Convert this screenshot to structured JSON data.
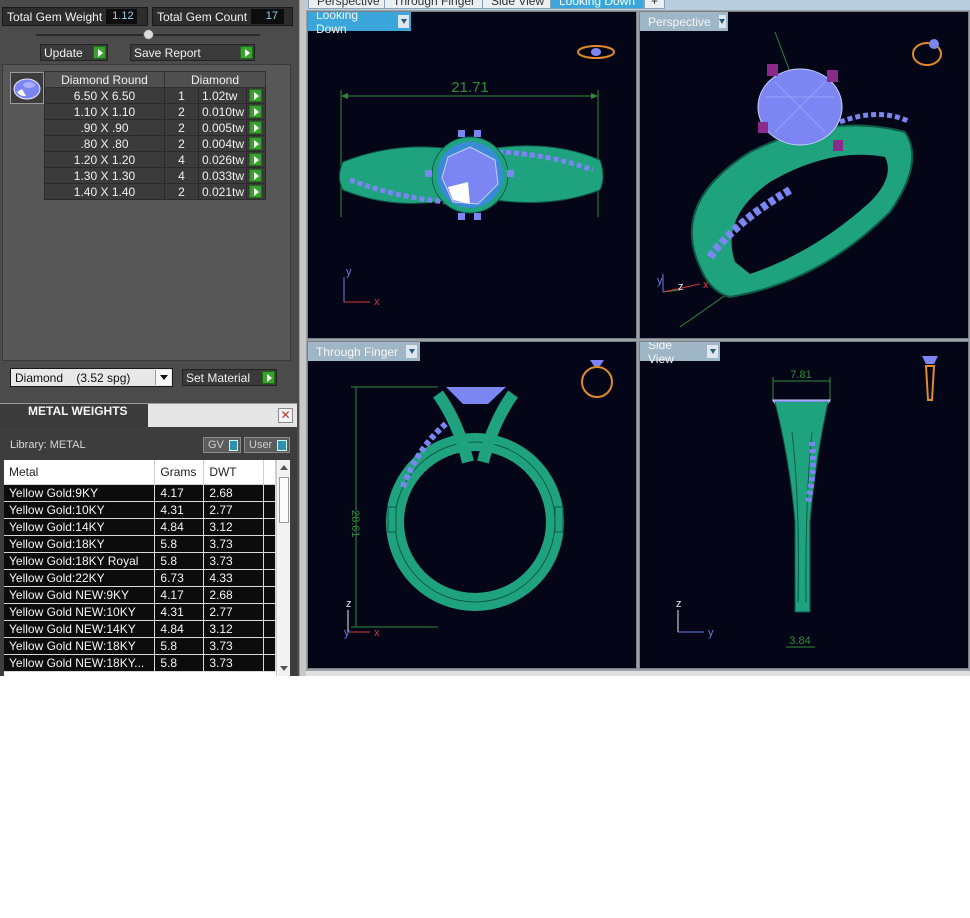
{
  "gem_summary": {
    "total_weight_label": "Total Gem Weight",
    "total_weight_value": "1.12",
    "total_count_label": "Total Gem Count",
    "total_count_value": "17"
  },
  "actions": {
    "update_label": "Update",
    "save_report_label": "Save Report",
    "set_material_label": "Set Material"
  },
  "gem_table": {
    "headers": [
      "Diamond Round",
      "Diamond"
    ],
    "rows": [
      {
        "size": "6.50 X 6.50",
        "count": "1",
        "weight": "1.02tw"
      },
      {
        "size": "1.10 X 1.10",
        "count": "2",
        "weight": "0.010tw"
      },
      {
        "size": ".90 X .90",
        "count": "2",
        "weight": "0.005tw"
      },
      {
        "size": ".80 X .80",
        "count": "2",
        "weight": "0.004tw"
      },
      {
        "size": "1.20 X 1.20",
        "count": "4",
        "weight": "0.026tw"
      },
      {
        "size": "1.30 X 1.30",
        "count": "4",
        "weight": "0.033tw"
      },
      {
        "size": "1.40 X 1.40",
        "count": "2",
        "weight": "0.021tw"
      }
    ]
  },
  "material": {
    "selected": "Diamond    (3.52 spg)"
  },
  "metal_weights": {
    "title": "METAL WEIGHTS",
    "library_label": "Library: METAL",
    "gv_label": "GV",
    "user_label": "User",
    "headers": [
      "Metal",
      "Grams",
      "DWT"
    ],
    "rows": [
      {
        "metal": "Yellow Gold:9KY",
        "grams": "4.17",
        "dwt": "2.68"
      },
      {
        "metal": "Yellow Gold:10KY",
        "grams": "4.31",
        "dwt": "2.77"
      },
      {
        "metal": "Yellow Gold:14KY",
        "grams": "4.84",
        "dwt": "3.12"
      },
      {
        "metal": "Yellow Gold:18KY",
        "grams": "5.8",
        "dwt": "3.73"
      },
      {
        "metal": "Yellow Gold:18KY Royal",
        "grams": "5.8",
        "dwt": "3.73"
      },
      {
        "metal": "Yellow Gold:22KY",
        "grams": "6.73",
        "dwt": "4.33"
      },
      {
        "metal": "Yellow Gold NEW:9KY",
        "grams": "4.17",
        "dwt": "2.68"
      },
      {
        "metal": "Yellow Gold NEW:10KY",
        "grams": "4.31",
        "dwt": "2.77"
      },
      {
        "metal": "Yellow Gold NEW:14KY",
        "grams": "4.84",
        "dwt": "3.12"
      },
      {
        "metal": "Yellow Gold NEW:18KY",
        "grams": "5.8",
        "dwt": "3.73"
      },
      {
        "metal": "Yellow Gold NEW:18KY...",
        "grams": "5.8",
        "dwt": "3.73"
      }
    ]
  },
  "top_tabs": [
    "Perspective",
    "Through Finger",
    "Side View",
    "Looking Down"
  ],
  "viewports": {
    "looking_down": {
      "label": "Looking Down",
      "dimension": "21.71",
      "axis_a": "y",
      "axis_b": "x"
    },
    "perspective": {
      "label": "Perspective",
      "axis_a": "y",
      "axis_b": "z",
      "axis_c": "x"
    },
    "through_finger": {
      "label": "Through Finger",
      "dimension": "28.61",
      "axis_a": "z",
      "axis_b": "y",
      "axis_c": "x"
    },
    "side_view": {
      "label": "Side View",
      "dimension_top": "7.81",
      "dimension_bottom": "3.84",
      "axis_a": "z",
      "axis_b": "y"
    }
  },
  "colors": {
    "metal_green": "#1fa37f",
    "gem_blue": "#7b86f2",
    "prong_purple": "#8a2a8a",
    "dimension_green": "#2f8a3a",
    "axis_red": "#d23a3a",
    "axis_blue": "#6a7fd8",
    "accent_tab": "#3aa6dc"
  }
}
